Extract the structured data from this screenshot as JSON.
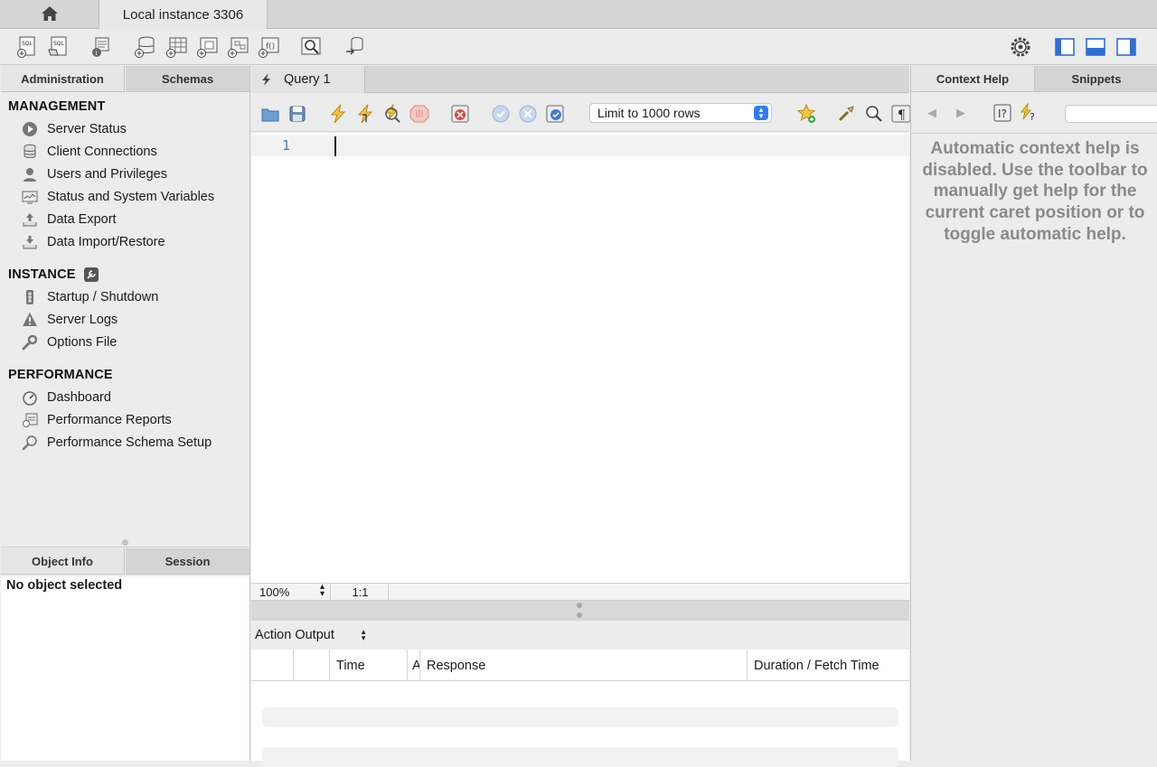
{
  "tabs": {
    "home_icon": "home-icon",
    "connection": "Local instance 3306"
  },
  "toolbar": {
    "icons": [
      "new-sql-tab-icon",
      "open-sql-script-icon",
      "inspector-icon",
      "create-schema-icon",
      "create-table-icon",
      "create-view-icon",
      "create-procedure-icon",
      "create-function-icon",
      "search-table-data-icon",
      "reconnect-icon"
    ],
    "settings_icon": "gear-icon",
    "layout_icons": [
      "toggle-sidebar-icon",
      "toggle-output-icon",
      "toggle-secondary-sidebar-icon"
    ]
  },
  "sidebar": {
    "tabs": [
      "Administration",
      "Schemas"
    ],
    "management": {
      "title": "MANAGEMENT",
      "items": [
        "Server Status",
        "Client Connections",
        "Users and Privileges",
        "Status and System Variables",
        "Data Export",
        "Data Import/Restore"
      ]
    },
    "instance": {
      "title": "INSTANCE",
      "items": [
        "Startup / Shutdown",
        "Server Logs",
        "Options File"
      ]
    },
    "performance": {
      "title": "PERFORMANCE",
      "items": [
        "Dashboard",
        "Performance Reports",
        "Performance Schema Setup"
      ]
    },
    "bottom_tabs": [
      "Object Info",
      "Session"
    ],
    "object_info": "No object selected"
  },
  "query": {
    "tab_label": "Query 1",
    "limit": "Limit to 1000 rows",
    "line_number": "1",
    "zoom": "100%",
    "position": "1:1"
  },
  "output": {
    "selector": "Action Output",
    "columns": [
      "Time",
      "A",
      "Response",
      "Duration / Fetch Time"
    ]
  },
  "right_panel": {
    "tabs": [
      "Context Help",
      "Snippets"
    ],
    "help_text": "Automatic context help is disabled. Use the toolbar to manually get help for the current caret position or to toggle automatic help."
  },
  "colors": {
    "accent": "#2f7cf6",
    "line_number": "#4a7fb5",
    "help_text": "#8a8a8a"
  }
}
